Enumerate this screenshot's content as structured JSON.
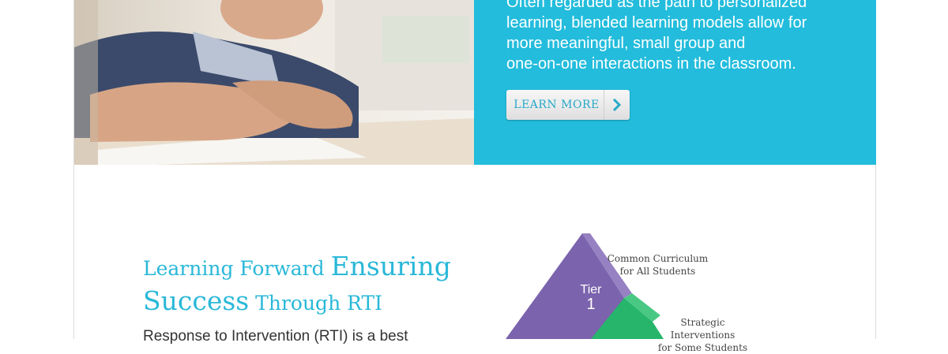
{
  "hero": {
    "text_lines": [
      "Often regarded as the path to personalized",
      "learning, blended learning models allow for",
      "more meaningful, small group and",
      "one-on-one interactions in the classroom."
    ],
    "button_label": "LEARN MORE",
    "panel_color": "#23bcdc"
  },
  "section": {
    "headline": {
      "part1": "Learning Forward ",
      "part2": "Ensuring",
      "part3": "Success",
      "part4": " Through RTI"
    },
    "body_start": "Response to Intervention (RTI) is a best"
  },
  "pyramid": {
    "tier1_label": "Tier",
    "tier1_number": "1",
    "tier1_caption_line1": "Common Curriculum",
    "tier1_caption_line2": "for All Students",
    "tier2_caption_line1": "Strategic Interventions",
    "tier2_caption_line2": "for Some Students",
    "colors": {
      "tier1": "#7b63ad",
      "tier2": "#26b56b"
    }
  }
}
